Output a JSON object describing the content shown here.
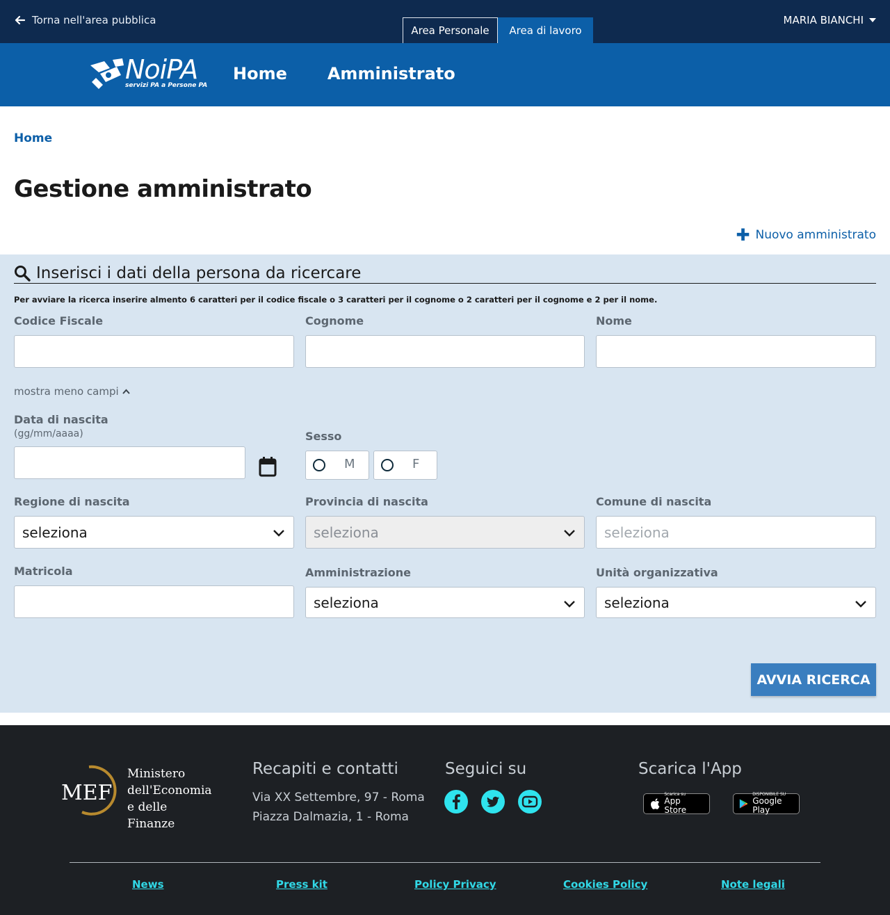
{
  "topbar": {
    "back_label": "Torna nell'area pubblica",
    "tab_personal": "Area Personale",
    "tab_work": "Area di lavoro",
    "user_name": "MARIA BIANCHI"
  },
  "header": {
    "brand": "NoiPA",
    "tagline": "servizi PA a Persone PA",
    "nav": [
      "Home",
      "Amministrato"
    ]
  },
  "breadcrumb": "Home",
  "page_title": "Gestione amministrato",
  "new_link": "Nuovo amministrato",
  "search": {
    "title": "Inserisci i dati della persona da ricercare",
    "hint": "Per avviare la ricerca inserire almento 6 caratteri per il codice fiscale o 3 caratteri per il cognome o 2 caratteri per il cognome e 2 per il nome.",
    "codice_fiscale_label": "Codice Fiscale",
    "cognome_label": "Cognome",
    "nome_label": "Nome",
    "toggle_label": "mostra meno campi",
    "data_nascita_label": "Data di nascita",
    "data_nascita_format": "(gg/mm/aaaa)",
    "sesso_label": "Sesso",
    "sesso_options": [
      "M",
      "F"
    ],
    "regione_label": "Regione di nascita",
    "regione_value": "seleziona",
    "provincia_label": "Provincia di nascita",
    "provincia_value": "seleziona",
    "comune_label": "Comune di nascita",
    "comune_placeholder": "seleziona",
    "matricola_label": "Matricola",
    "amministrazione_label": "Amministrazione",
    "amministrazione_value": "seleziona",
    "unita_label": "Unità organizzativa",
    "unita_value": "seleziona",
    "submit_label": "AVVIA RICERCA"
  },
  "footer": {
    "mef_logo_text": "MEF",
    "mef_lines": [
      "Ministero",
      "dell'Economia",
      "e delle Finanze"
    ],
    "contacts_title": "Recapiti e contatti",
    "addresses": [
      "Via XX Settembre, 97 - Roma",
      "Piazza Dalmazia, 1 - Roma"
    ],
    "social_title": "Seguici su",
    "social_icons": [
      "facebook-icon",
      "twitter-icon",
      "youtube-icon"
    ],
    "app_title": "Scarica l'App",
    "app_store_small": "Scarica su",
    "app_store": "App Store",
    "google_play_small": "DISPONIBILE SU",
    "google_play": "Google Play",
    "links": [
      "News",
      "Press kit",
      "Policy Privacy",
      "Cookies Policy",
      "Note legali"
    ]
  },
  "colors": {
    "topbar": "#0e2a4f",
    "header": "#0c5fa8",
    "panel": "#d8e5f1",
    "button": "#3a7ebf",
    "footer": "#1d2024",
    "footer_links": "#31d8e6",
    "social": "#2fe3ee"
  }
}
